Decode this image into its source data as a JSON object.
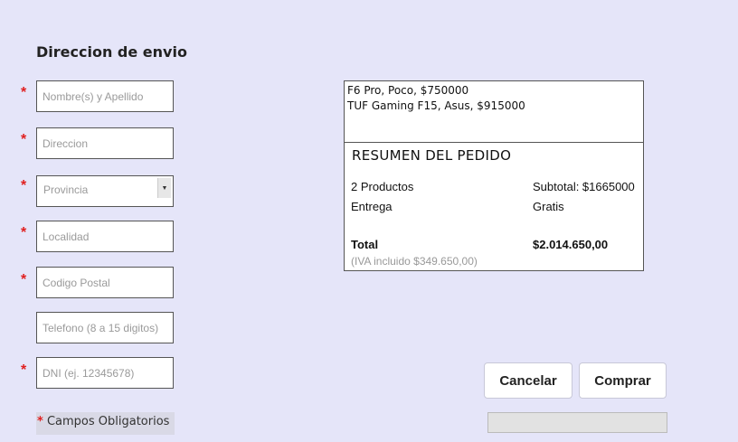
{
  "form": {
    "title": "Direccion de envio",
    "required_mark": "*",
    "fields": {
      "nombre": {
        "placeholder": "Nombre(s) y Apellido",
        "required": true
      },
      "direccion": {
        "placeholder": "Direccion",
        "required": true
      },
      "provincia": {
        "selected": "Provincia",
        "required": true
      },
      "localidad": {
        "placeholder": "Localidad",
        "required": true
      },
      "codigo_postal": {
        "placeholder": "Codigo Postal",
        "required": true
      },
      "telefono": {
        "placeholder": "Telefono (8 a 15 digitos)",
        "required": false
      },
      "dni": {
        "placeholder": "DNI (ej. 12345678)",
        "required": true
      }
    },
    "required_note": "Campos Obligatorios"
  },
  "order": {
    "items": [
      "F6 Pro, Poco, $750000",
      "TUF Gaming F15, Asus, $915000"
    ],
    "summary_title": "RESUMEN DEL PEDIDO",
    "products_count": "2 Productos",
    "subtotal": "Subtotal: $1665000",
    "delivery_label": "Entrega",
    "delivery_value": "Gratis",
    "total_label": "Total",
    "total_value": "$2.014.650,00",
    "tax_note": "(IVA incluido $349.650,00)"
  },
  "actions": {
    "cancel": "Cancelar",
    "buy": "Comprar"
  },
  "colors": {
    "background": "#e5e5f9",
    "required": "#e02020"
  },
  "icons": {
    "select_arrow": "chevron-down-icon"
  }
}
